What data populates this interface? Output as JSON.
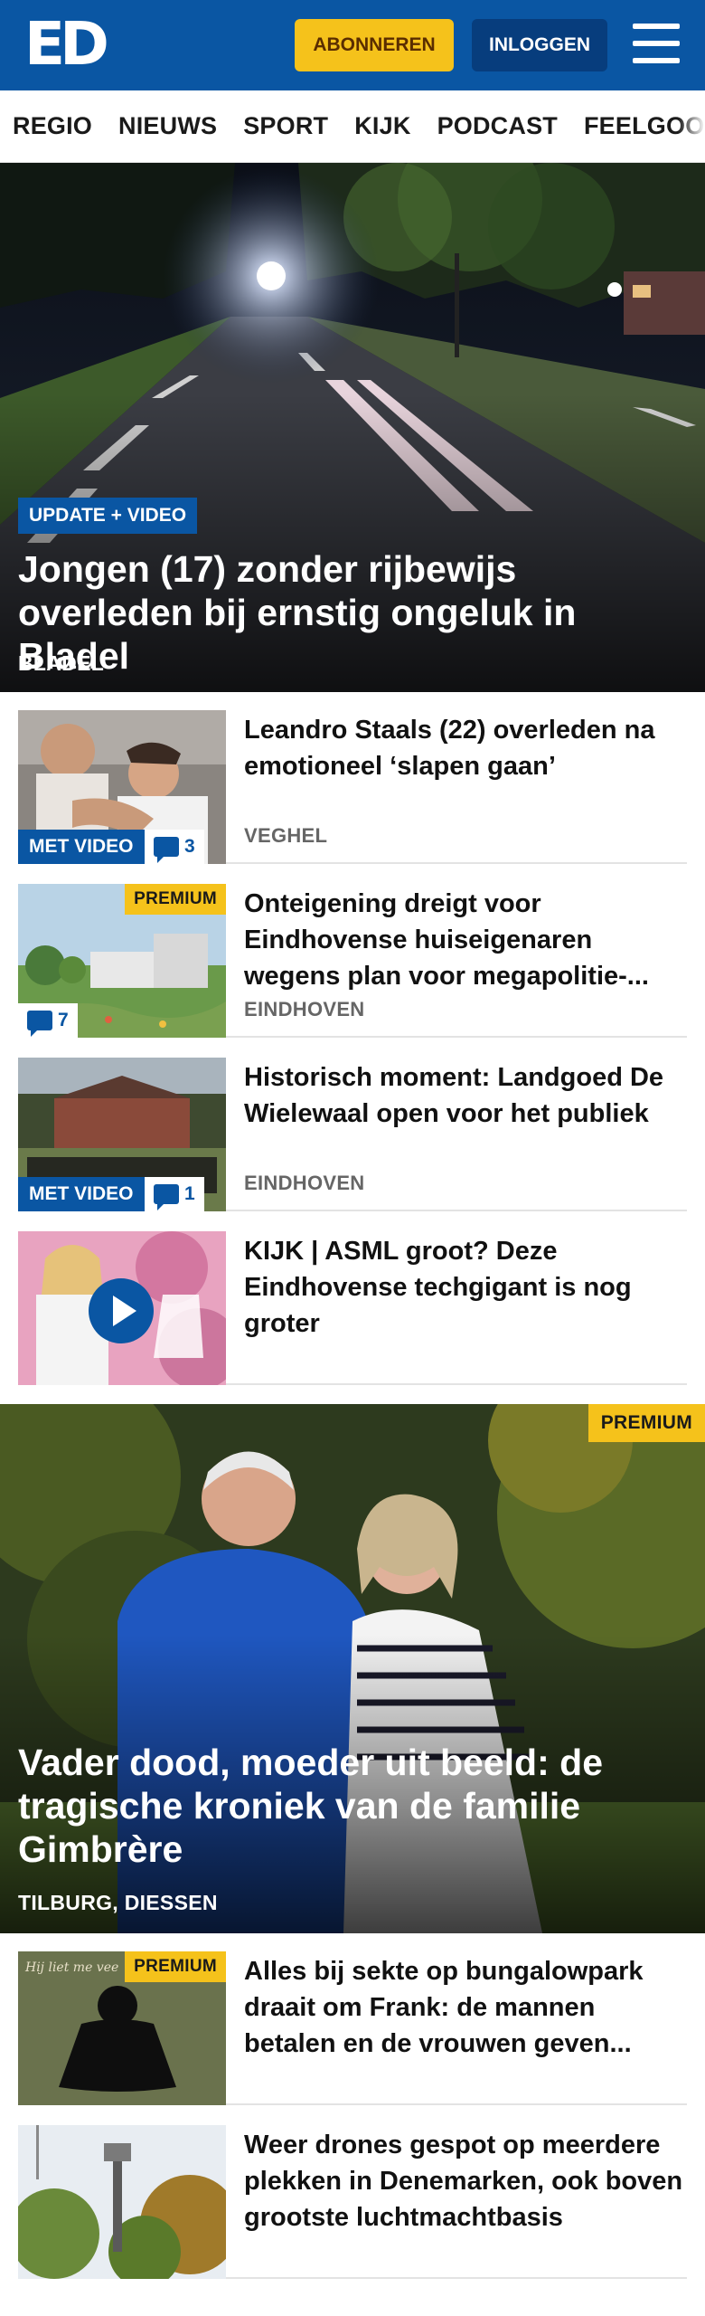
{
  "header": {
    "logo_text": "ED",
    "subscribe_label": "ABONNEREN",
    "login_label": "INLOGGEN",
    "menu_icon": "hamburger-menu-icon",
    "brand_color": "#0a56a3",
    "accent_color": "#f5c21b"
  },
  "nav": {
    "items": [
      "REGIO",
      "NIEUWS",
      "SPORT",
      "KIJK",
      "PODCAST",
      "FEELGOOD"
    ]
  },
  "hero": {
    "badge": "UPDATE + VIDEO",
    "title": "Jongen (17) zonder rijbewijs overleden bij ernstig ongeluk in Bladel",
    "place": "BLADEL"
  },
  "articles": [
    {
      "title": "Leandro Staals (22) overleden na emotioneel ‘slapen gaan’",
      "place": "VEGHEL",
      "video_label": "MET VIDEO",
      "comments": "3"
    },
    {
      "title": "Onteigening dreigt voor Eindhovense huiseigenaren wegens plan voor megapolitie-...",
      "place": "EINDHOVEN",
      "premium_label": "PREMIUM",
      "comments": "7"
    },
    {
      "title": "Historisch moment: Landgoed De Wielewaal open voor het publiek",
      "place": "EINDHOVEN",
      "video_label": "MET VIDEO",
      "comments": "1"
    },
    {
      "title": "KIJK | ASML groot? Deze Eindhovense techgigant is nog groter",
      "place": ""
    }
  ],
  "feature": {
    "premium_label": "PREMIUM",
    "title": "Vader dood, moeder uit beeld: de tragische kroniek van de familie Gimbrère",
    "place": "TILBURG, DIESSEN"
  },
  "articles2": [
    {
      "title": "Alles bij sekte op bungalowpark draait om Frank: de mannen betalen en de vrouwen geven...",
      "premium_label": "PREMIUM",
      "thumb_caption": "Hij liet me vee"
    },
    {
      "title": "Weer drones gespot op meerdere plekken in Denemarken, ook boven grootste luchtmachtbasis"
    }
  ]
}
